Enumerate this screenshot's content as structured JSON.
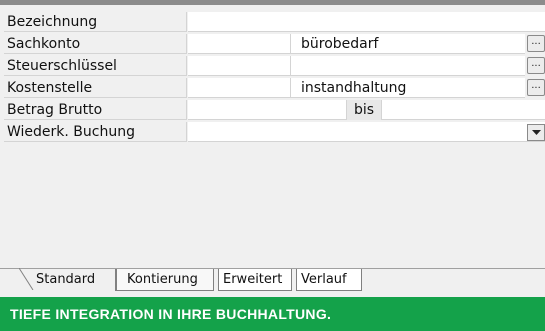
{
  "fields": [
    {
      "label": "Bezeichnung"
    },
    {
      "label": "Sachkonto",
      "value": "bürobedarf",
      "button": "..."
    },
    {
      "label": "Steuerschlüssel",
      "button": "..."
    },
    {
      "label": "Kostenstelle",
      "value": "instandhaltung",
      "button": "..."
    },
    {
      "label": "Betrag Brutto",
      "mid": "bis"
    },
    {
      "label": "Wiederk. Buchung",
      "dropdown": "chevron-down-icon"
    }
  ],
  "tabs": [
    "Standard",
    "Kontierung",
    "Erweitert",
    "Verlauf"
  ],
  "active_tab": "Kontierung",
  "banner": {
    "text": "TIEFE INTEGRATION IN IHRE BUCHHALTUNG.",
    "color": "#14a24a"
  }
}
